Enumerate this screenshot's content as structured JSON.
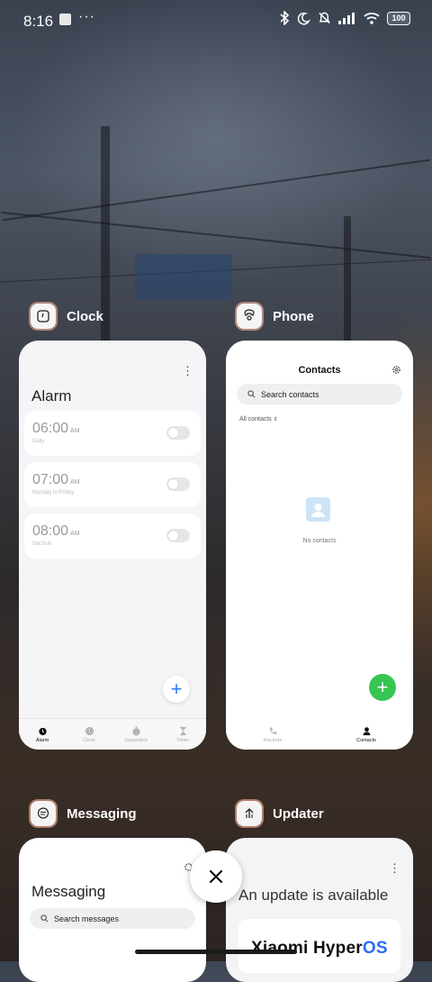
{
  "status_bar": {
    "time": "8:16",
    "more": "···",
    "battery": "100",
    "icons": [
      "bluetooth-icon",
      "moon-icon",
      "bell-off-icon",
      "signal-icon",
      "wifi-icon",
      "battery-icon"
    ]
  },
  "recents": [
    {
      "app": "Clock",
      "icon": "clock-icon",
      "screen": {
        "title": "Alarm",
        "alarms": [
          {
            "time": "06:00",
            "ampm": "AM",
            "repeat": "Daily"
          },
          {
            "time": "07:00",
            "ampm": "AM",
            "repeat": "Monday to Friday"
          },
          {
            "time": "08:00",
            "ampm": "AM",
            "repeat": "Sat Sun"
          }
        ],
        "tabs": [
          "Alarm",
          "Clock",
          "Stopwatch",
          "Timer"
        ],
        "active_tab": "Alarm"
      }
    },
    {
      "app": "Phone",
      "icon": "phone-app-icon",
      "screen": {
        "title": "Contacts",
        "search_placeholder": "Search contacts",
        "filter": "All contacts",
        "empty_text": "No contacts",
        "tabs": [
          "Recents",
          "Contacts"
        ],
        "active_tab": "Contacts"
      }
    },
    {
      "app": "Messaging",
      "icon": "messaging-icon",
      "screen": {
        "title": "Messaging",
        "search_placeholder": "Search messages"
      }
    },
    {
      "app": "Updater",
      "icon": "updater-icon",
      "screen": {
        "title": "An update is available",
        "brand": "Xiaomi Hyper",
        "brand_suffix": "OS"
      }
    }
  ],
  "colors": {
    "accent_blue": "#2f7df6",
    "fab_green": "#36c552"
  }
}
